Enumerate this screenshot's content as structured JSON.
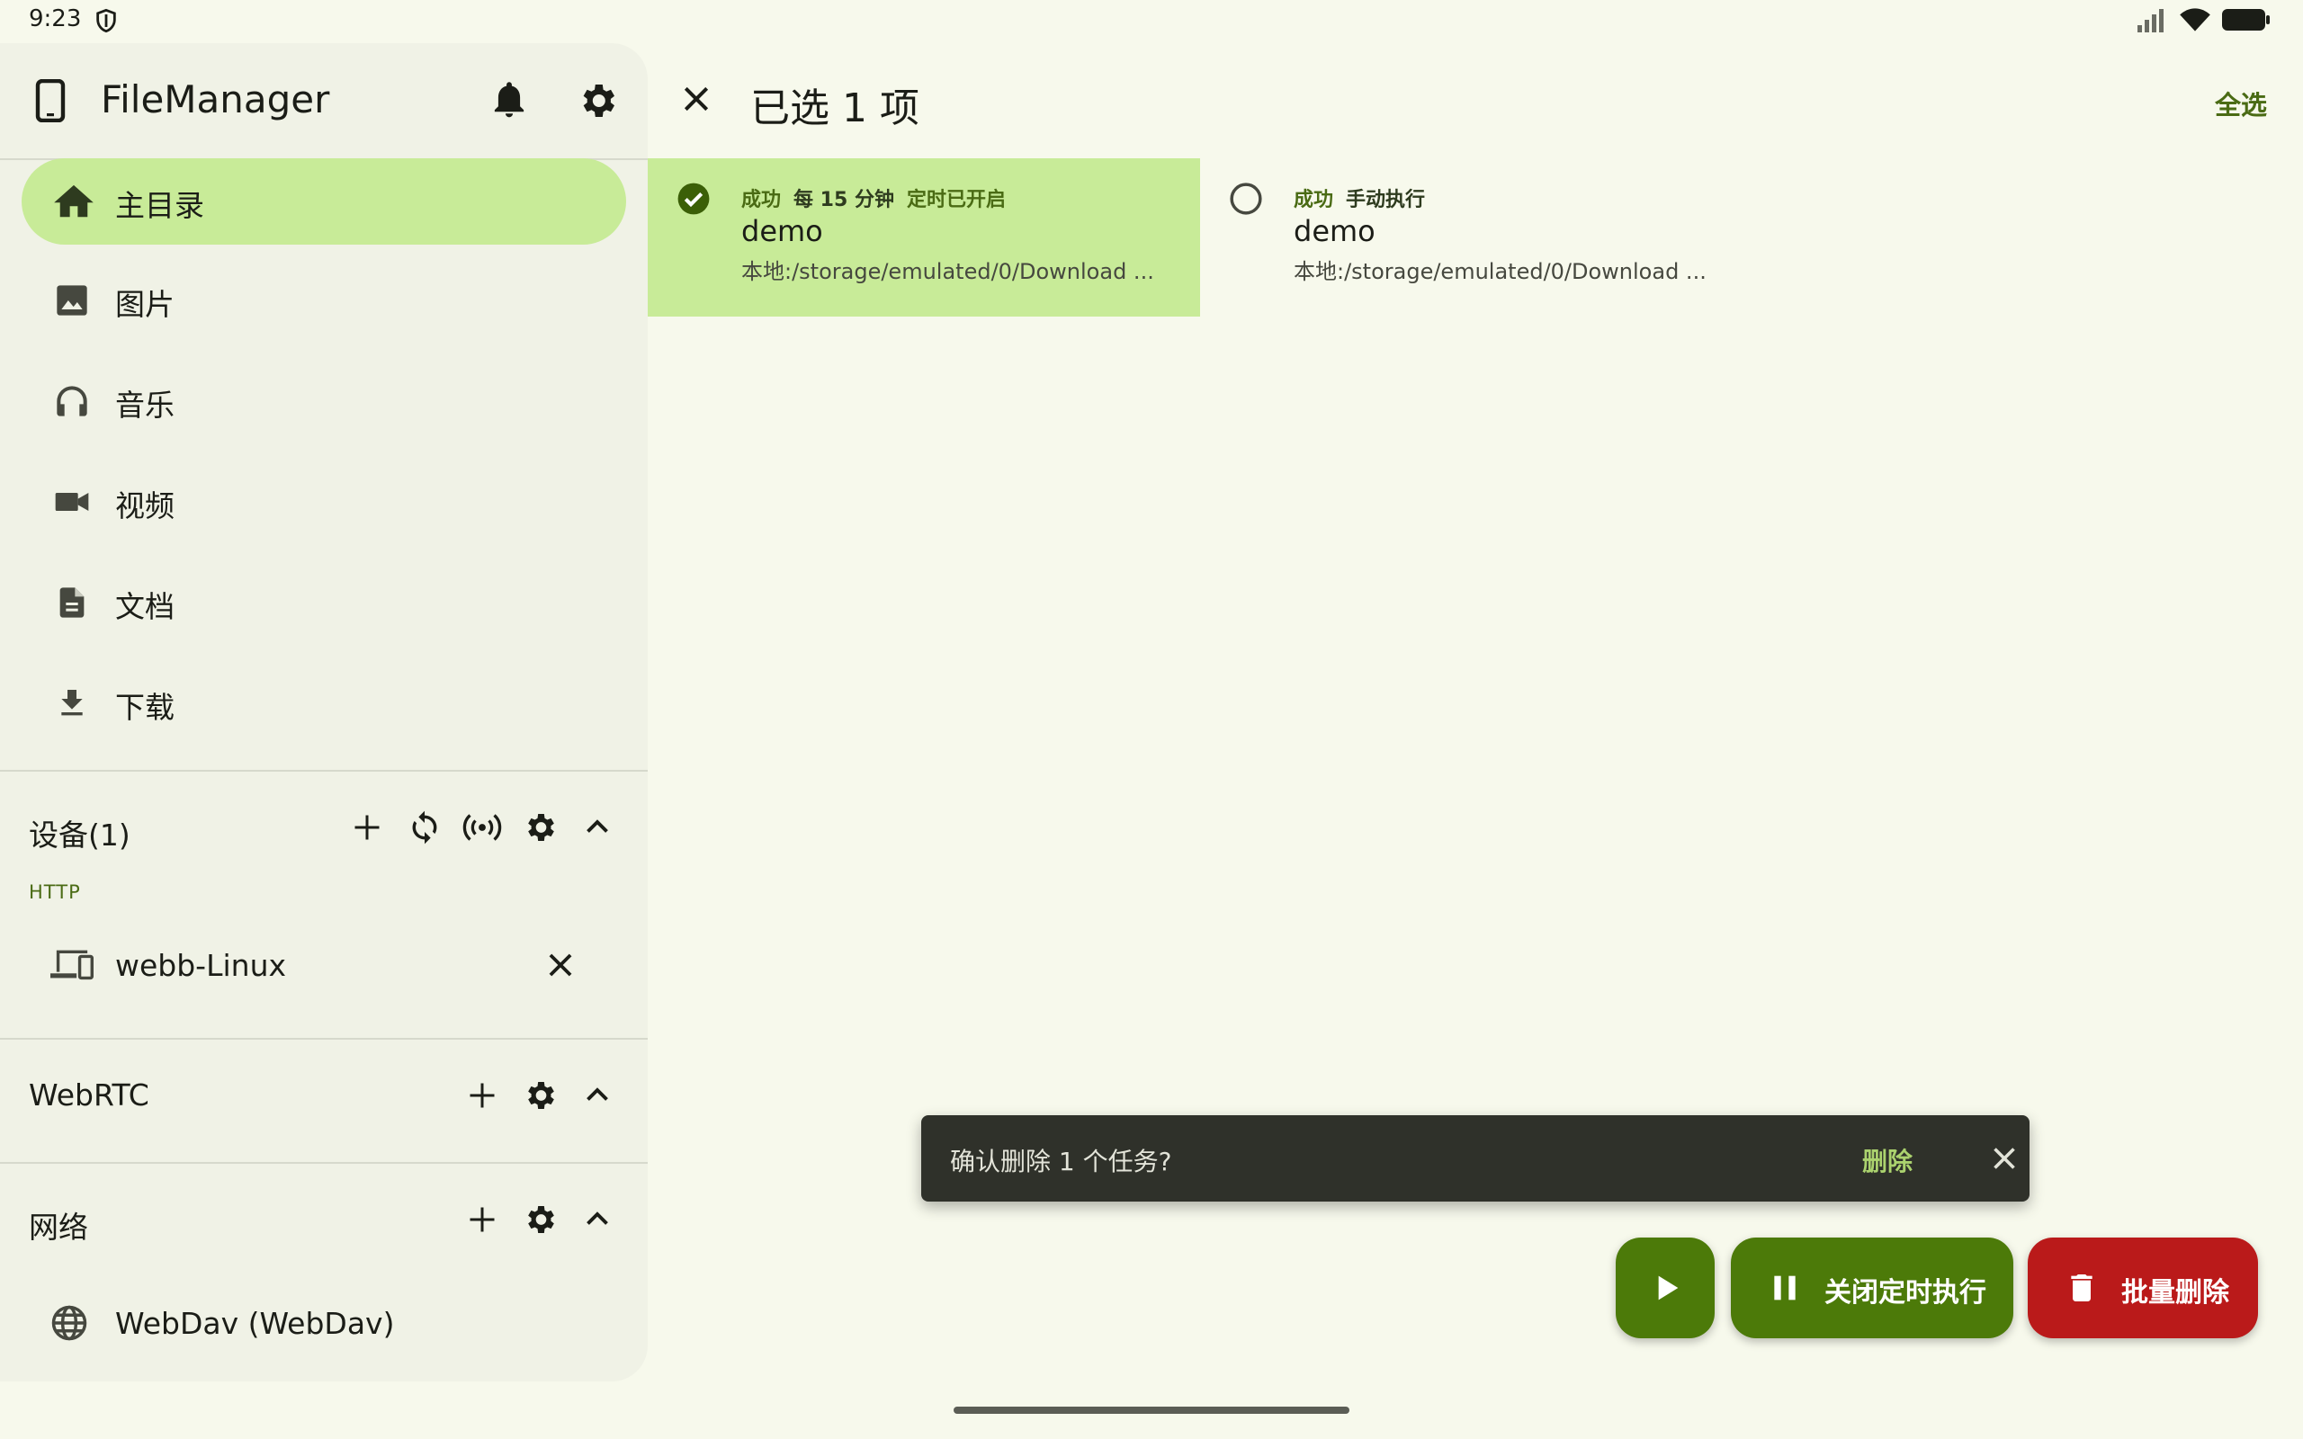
{
  "status_bar": {
    "time": "9:23"
  },
  "sidebar": {
    "app_title": "FileManager",
    "nav_items": [
      {
        "label": "主目录",
        "icon": "home-icon",
        "active": true
      },
      {
        "label": "图片",
        "icon": "image-icon"
      },
      {
        "label": "音乐",
        "icon": "headphones-icon"
      },
      {
        "label": "视频",
        "icon": "videocam-icon"
      },
      {
        "label": "文档",
        "icon": "document-icon"
      },
      {
        "label": "下载",
        "icon": "download-icon"
      }
    ],
    "devices": {
      "title": "设备(1)",
      "group_label": "HTTP",
      "items": [
        {
          "label": "webb-Linux",
          "icon": "devices-icon"
        }
      ]
    },
    "webrtc": {
      "title": "WebRTC"
    },
    "network": {
      "title": "网络",
      "items": [
        {
          "label": "WebDav (WebDav)",
          "icon": "globe-icon"
        }
      ]
    }
  },
  "main": {
    "header": {
      "title": "已选 1 项",
      "select_all": "全选"
    },
    "tasks": [
      {
        "status": "成功",
        "schedule": "每 15 分钟",
        "auto": "定时已开启",
        "name": "demo",
        "path": "本地:/storage/emulated/0/Download ...",
        "selected": true
      },
      {
        "status": "成功",
        "schedule": "手动执行",
        "name": "demo",
        "path": "本地:/storage/emulated/0/Download ...",
        "selected": false
      }
    ]
  },
  "snackbar": {
    "message": "确认删除 1 个任务?",
    "action": "删除"
  },
  "fabs": {
    "pause_label": "关闭定时执行",
    "delete_label": "批量删除"
  },
  "colors": {
    "primary": "#4c7a09",
    "selected": "#c8eb98",
    "error": "#ba1a1a",
    "background": "#f7f9ec"
  }
}
